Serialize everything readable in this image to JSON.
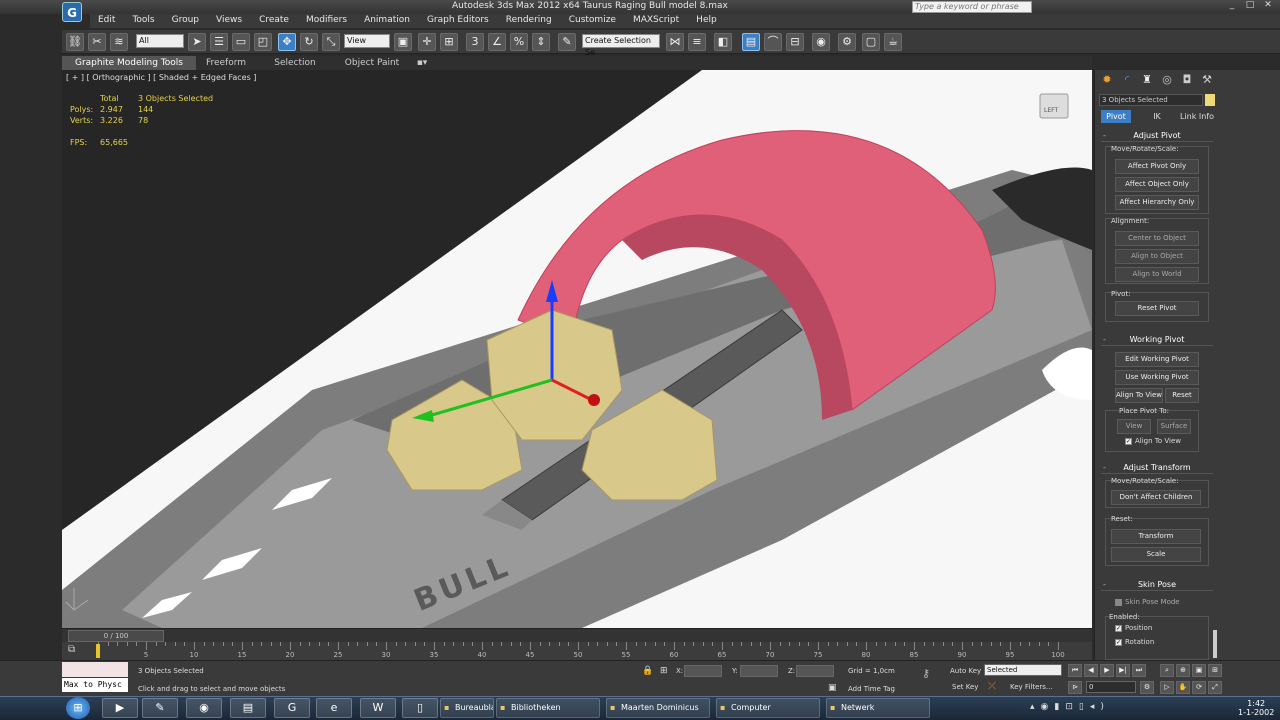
{
  "window": {
    "title": "Autodesk 3ds Max  2012 x64      Taurus Raging Bull model 8.max",
    "search_placeholder": "Type a keyword or phrase"
  },
  "menu": [
    "Edit",
    "Tools",
    "Group",
    "Views",
    "Create",
    "Modifiers",
    "Animation",
    "Graph Editors",
    "Rendering",
    "Customize",
    "MAXScript",
    "Help"
  ],
  "toolbar": {
    "selection_filter": "All",
    "reference_coord": "View",
    "named_selection": "Create Selection Se",
    "snap_label": "3"
  },
  "ribbon": {
    "tabs": [
      "Graphite Modeling Tools",
      "Freeform",
      "Selection",
      "Object Paint"
    ]
  },
  "viewport": {
    "label": "[ + ] [ Orthographic ] [ Shaded + Edged Faces ]",
    "stats": {
      "header_total": "Total",
      "header_selected": "3 Objects Selected",
      "polys_label": "Polys:",
      "polys_total": "2.947",
      "polys_selected": "144",
      "verts_label": "Verts:",
      "verts_total": "3.226",
      "verts_selected": "78",
      "fps_label": "FPS:",
      "fps_value": "65,665"
    },
    "viewcube_label": "LEFT",
    "gun_lettering": "BULL",
    "colors": {
      "trigger_guard": "#e0607a",
      "cylinders": "#d8c88a",
      "frame": "#8a8a8a",
      "background": "#262626"
    }
  },
  "command_panel": {
    "object_name": "3 Objects Selected",
    "tabs": [
      "Pivot",
      "IK",
      "Link Info"
    ],
    "adjust_pivot": {
      "title": "Adjust Pivot",
      "move_rotate_scale": "Move/Rotate/Scale:",
      "affect_pivot_only": "Affect Pivot Only",
      "affect_object_only": "Affect Object Only",
      "affect_hierarchy_only": "Affect Hierarchy Only",
      "alignment": "Alignment:",
      "center_to_object": "Center to Object",
      "align_to_object": "Align to Object",
      "align_to_world": "Align to World",
      "pivot": "Pivot:",
      "reset_pivot": "Reset Pivot"
    },
    "working_pivot": {
      "title": "Working Pivot",
      "edit_working_pivot": "Edit Working Pivot",
      "use_working_pivot": "Use Working Pivot",
      "align_to_view": "Align To View",
      "reset": "Reset",
      "place_pivot_to": "Place Pivot To:",
      "view": "View",
      "surface": "Surface",
      "align_to_view_check": "Align To View"
    },
    "adjust_transform": {
      "title": "Adjust Transform",
      "move_rotate_scale": "Move/Rotate/Scale:",
      "dont_affect_children": "Don't Affect Children",
      "reset": "Reset:",
      "transform": "Transform",
      "scale": "Scale"
    },
    "skin_pose": {
      "title": "Skin Pose",
      "skin_pose_mode": "Skin Pose Mode",
      "enabled": "Enabled:",
      "position": "Position",
      "rotation": "Rotation"
    }
  },
  "timeline": {
    "frame_display": "0 / 100",
    "current_frame": 0,
    "ticks": [
      "0",
      "5",
      "10",
      "15",
      "20",
      "25",
      "30",
      "35",
      "40",
      "45",
      "50",
      "55",
      "60",
      "65",
      "70",
      "75",
      "80",
      "85",
      "90",
      "95",
      "100"
    ]
  },
  "status": {
    "maxscript_listener": "Max to Physc",
    "selection_count": "3 Objects Selected",
    "prompt": "Click and drag to select and move objects",
    "x_label": "X:",
    "y_label": "Y:",
    "z_label": "Z:",
    "grid": "Grid = 1,0cm",
    "add_time_tag": "Add Time Tag",
    "auto_key": "Auto Key",
    "auto_key_mode": "Selected",
    "set_key": "Set Key",
    "key_filters": "Key Filters...",
    "frame_field": "0"
  },
  "taskbar": {
    "tasks": [
      "Bureaublad",
      "Bibliotheken",
      "Maarten Dominicus",
      "Computer",
      "Netwerk"
    ],
    "time": "1:42",
    "date": "1-1-2002"
  }
}
